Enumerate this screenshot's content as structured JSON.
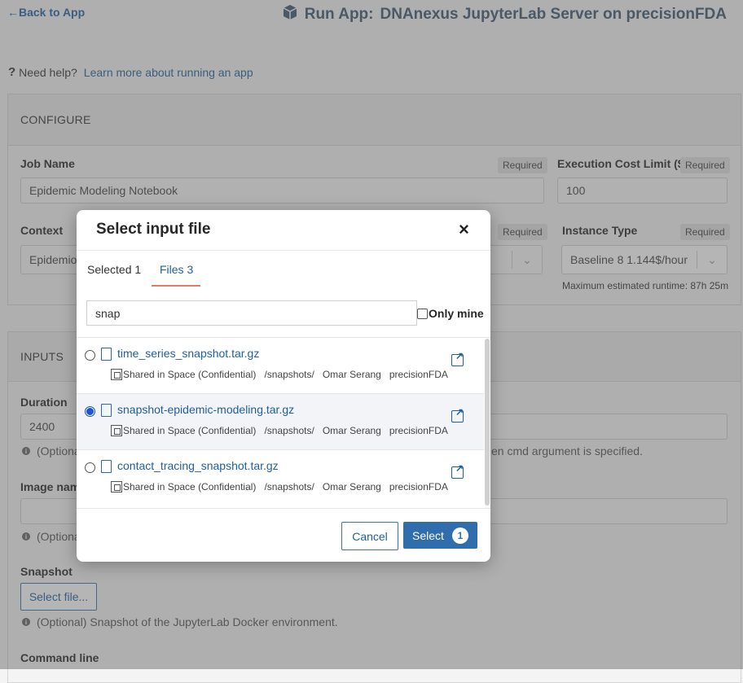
{
  "header": {
    "back_label": "Back to App",
    "title_prefix": "Run App:",
    "title": "DNAnexus JupyterLab Server on precisionFDA"
  },
  "help": {
    "text": "Need help?",
    "link": "Learn more about running an app"
  },
  "configure": {
    "heading": "CONFIGURE",
    "required_label": "Required",
    "job_name_label": "Job Name",
    "job_name_value": "Epidemic Modeling Notebook",
    "cost_limit_label": "Execution Cost Limit ($)",
    "cost_limit_value": "100",
    "context_label": "Context",
    "context_value": "Epidemio",
    "instance_label": "Instance Type",
    "instance_value": "Baseline 8 1.144$/hour",
    "runtime_note": "Maximum estimated runtime: 87h 25m"
  },
  "inputs": {
    "heading": "INPUTS",
    "duration_label": "Duration",
    "duration_value": "2400",
    "duration_hint": "(Optiona",
    "duration_hint_tail": "en cmd argument is specified.",
    "image_label": "Image name",
    "image_hint": "(Optiona",
    "snapshot_label": "Snapshot",
    "snapshot_button": "Select file...",
    "snapshot_hint": "(Optional) Snapshot of the JupyterLab Docker environment.",
    "command_label": "Command line"
  },
  "modal": {
    "title": "Select input file",
    "tabs": [
      {
        "label": "Selected 1"
      },
      {
        "label": "Files 3"
      }
    ],
    "search_value": "snap",
    "only_mine": "Only mine",
    "files": [
      {
        "name": "time_series_snapshot.tar.gz",
        "space": "Shared in Space (Confidential)",
        "path": "/snapshots/",
        "owner": "Omar Serang",
        "org": "precisionFDA",
        "selected": false
      },
      {
        "name": "snapshot-epidemic-modeling.tar.gz",
        "space": "Shared in Space (Confidential)",
        "path": "/snapshots/",
        "owner": "Omar Serang",
        "org": "precisionFDA",
        "selected": true
      },
      {
        "name": "contact_tracing_snapshot.tar.gz",
        "space": "Shared in Space (Confidential)",
        "path": "/snapshots/",
        "owner": "Omar Serang",
        "org": "precisionFDA",
        "selected": false
      }
    ],
    "cancel_label": "Cancel",
    "select_label": "Select",
    "select_count": "1"
  },
  "colors": {
    "accent": "#2f6dad",
    "link": "#1f5f9e",
    "tab_underline": "#e57868"
  }
}
